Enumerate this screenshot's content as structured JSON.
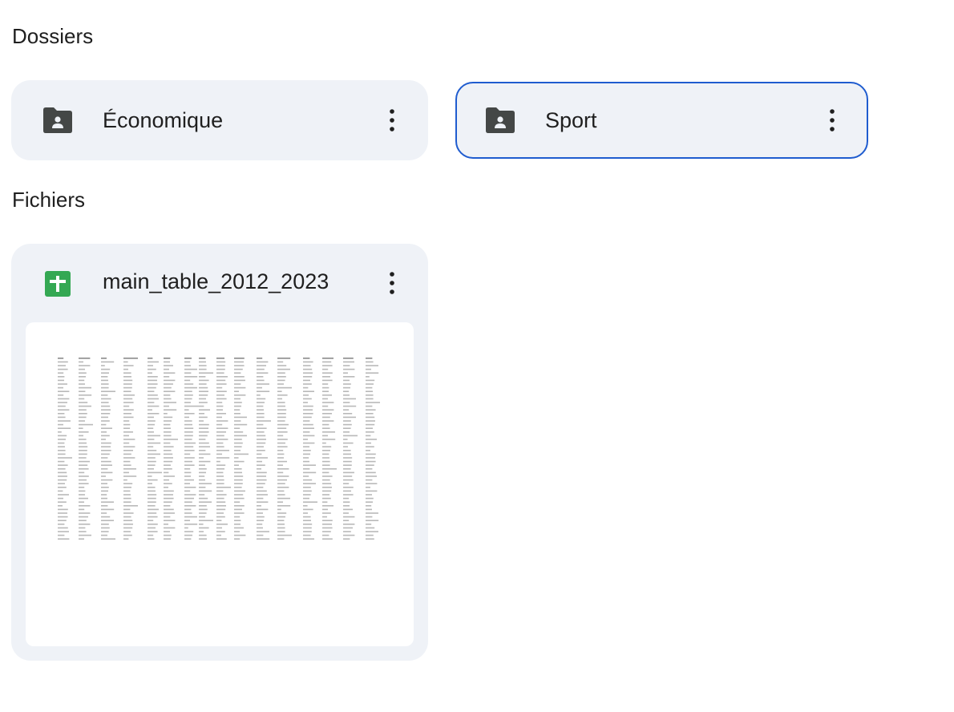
{
  "sections": {
    "folders_title": "Dossiers",
    "files_title": "Fichiers"
  },
  "folders": [
    {
      "name": "Économique",
      "icon": "shared-folder-icon",
      "selected": false
    },
    {
      "name": "Sport",
      "icon": "shared-folder-icon",
      "selected": true
    }
  ],
  "files": [
    {
      "name": "main_table_2012_2023",
      "icon": "google-sheets-icon"
    }
  ],
  "colors": {
    "card_bg": "#eff2f7",
    "selected_border": "#1f5ccf",
    "sheets_green": "#34a853"
  }
}
